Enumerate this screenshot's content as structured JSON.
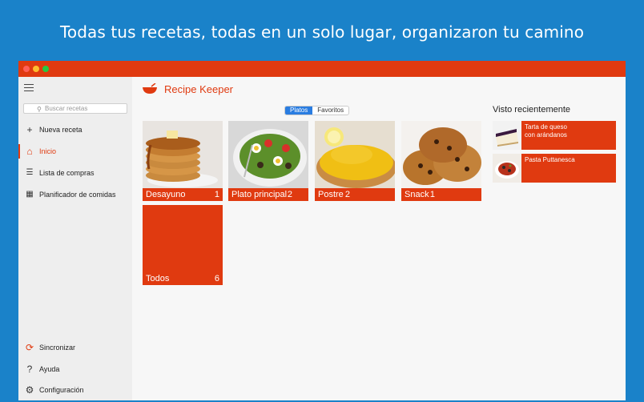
{
  "banner": {
    "text": "Todas tus recetas, todas en un solo lugar, organizaron tu camino"
  },
  "app": {
    "name": "Recipe Keeper"
  },
  "colors": {
    "accent": "#e03a10",
    "banner_bg": "#1a82c9",
    "toggle_on": "#2a7de1"
  },
  "sidebar": {
    "search_placeholder": "Buscar recetas",
    "items": [
      {
        "label": "Nueva receta",
        "icon": "plus-icon"
      },
      {
        "label": "Inicio",
        "icon": "home-icon",
        "active": true
      },
      {
        "label": "Lista de compras",
        "icon": "checklist-icon"
      },
      {
        "label": "Planificador de comidas",
        "icon": "calendar-icon"
      }
    ],
    "bottom_items": [
      {
        "label": "Sincronizar",
        "icon": "sync-icon"
      },
      {
        "label": "Ayuda",
        "icon": "question-icon"
      },
      {
        "label": "Configuración",
        "icon": "gear-icon"
      }
    ]
  },
  "toggle": {
    "option1": "Platos",
    "option2": "Favoritos",
    "selected": "Platos"
  },
  "categories": [
    {
      "label": "Desayuno",
      "count": "1"
    },
    {
      "label": "Plato principal",
      "count": "2"
    },
    {
      "label": "Postre",
      "count": "2"
    },
    {
      "label": "Snack",
      "count": "1"
    },
    {
      "label": "Todos",
      "count": "6"
    }
  ],
  "recent": {
    "title": "Visto recientemente",
    "items": [
      {
        "line1": "Tarta de queso",
        "line2": "con arándanos"
      },
      {
        "line1": "Pasta Puttanesca",
        "line2": ""
      }
    ]
  }
}
